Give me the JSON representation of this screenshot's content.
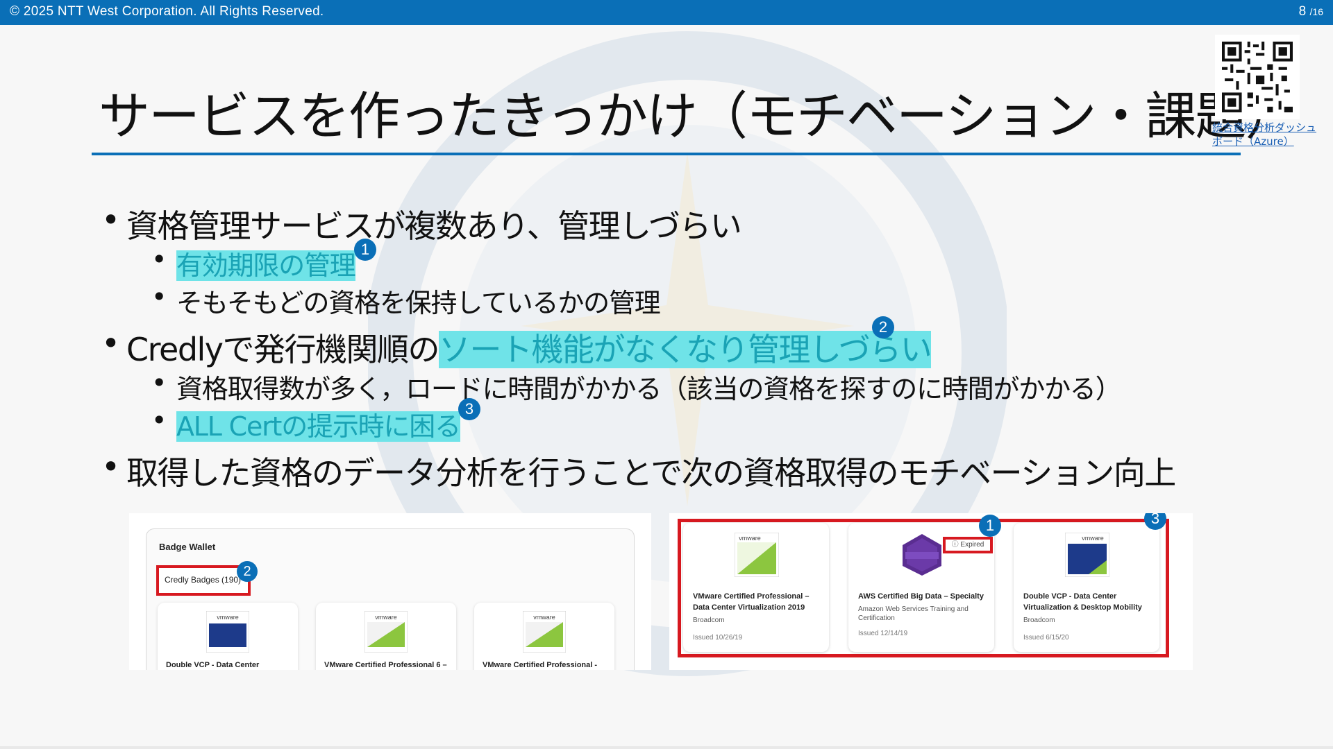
{
  "header": {
    "copyright": "© 2025 NTT  West Corporation. All Rights Reserved.",
    "page_current": "8",
    "page_total": "/16"
  },
  "title": "サービスを作ったきっかけ（モチベーション・課題）",
  "qr": {
    "link_text": "統合資格分析ダッシュボード（Azure）"
  },
  "bullets": {
    "b1": "資格管理サービスが複数あり、管理しづらい",
    "b1_1": "有効期限の管理",
    "b1_1_badge": "1",
    "b1_2": "そもそもどの資格を保持しているかの管理",
    "b2_prefix": "Credlyで発行機関順の",
    "b2_highlight": "ソート機能がなくなり管理しづらい",
    "b2_badge": "2",
    "b2_1": "資格取得数が多く，ロードに時間がかかる（該当の資格を探すのに時間がかかる）",
    "b2_2": "ALL Certの提示時に困る",
    "b2_2_badge": "3",
    "b3": "取得した資格のデータ分析を行うことで次の資格取得のモチベーション向上"
  },
  "left_screenshot": {
    "wallet_title": "Badge Wallet",
    "credly_count": "Credly Badges (190)",
    "badge_num": "2",
    "cards": [
      {
        "label": "Double VCP - Data Center"
      },
      {
        "label": "VMware Certified Professional 6 –"
      },
      {
        "label": "VMware Certified Professional -"
      }
    ]
  },
  "right_screenshot": {
    "badge_expired_num": "1",
    "badge_frame_num": "3",
    "expired_label": "ⓘ Expired",
    "cards": [
      {
        "name": "VMware Certified Professional – Data Center Virtualization 2019",
        "issuer": "Broadcom",
        "issued": "Issued 10/26/19"
      },
      {
        "name": "AWS Certified Big Data – Specialty",
        "issuer": "Amazon Web Services Training and Certification",
        "issued": "Issued 12/14/19"
      },
      {
        "name": "Double VCP - Data Center Virtualization & Desktop Mobility",
        "issuer": "Broadcom",
        "issued": "Issued 6/15/20"
      }
    ]
  },
  "colors": {
    "brand_blue": "#0a6fb7",
    "highlight": "#6fe3e8",
    "frame_red": "#d71920"
  }
}
